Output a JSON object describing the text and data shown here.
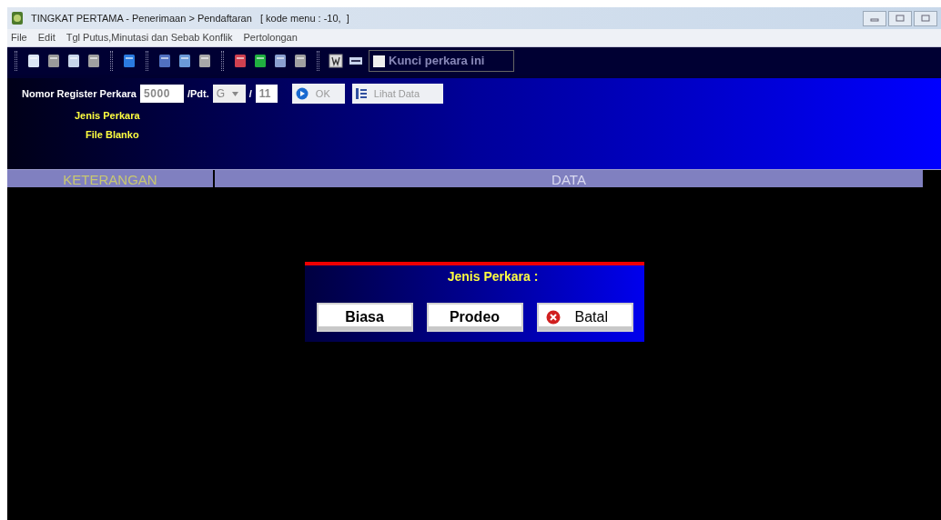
{
  "window": {
    "title": "TINGKAT PERTAMA - Penerimaan > Pendaftaran   [ kode menu : -10,  ]"
  },
  "menu": [
    "File",
    "Edit",
    "Tgl Putus,Minutasi dan Sebab Konflik",
    "Pertolongan"
  ],
  "toolbar": {
    "lock_checkbox": {
      "label": "Kunci perkara ini",
      "checked": false
    }
  },
  "form": {
    "register_label": "Nomor Register Perkara",
    "number": "5000",
    "pdt_label": "/Pdt.",
    "type_value": "G",
    "slash": "/",
    "year": "11",
    "ok_button": "OK",
    "view_button": "Lihat Data",
    "case_type_label": "Jenis Perkara",
    "blank_file_label": "File Blanko"
  },
  "columns": [
    "KETERANGAN",
    "DATA"
  ],
  "dialog": {
    "title": "Jenis Perkara :",
    "buttons": [
      "Biasa",
      "Prodeo",
      "Batal"
    ]
  }
}
